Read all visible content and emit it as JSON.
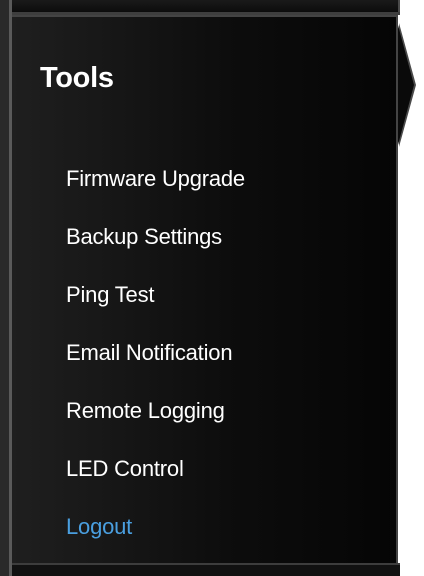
{
  "sidebar": {
    "title": "Tools",
    "items": [
      {
        "label": "Firmware Upgrade"
      },
      {
        "label": "Backup Settings"
      },
      {
        "label": "Ping Test"
      },
      {
        "label": "Email Notification"
      },
      {
        "label": "Remote Logging"
      },
      {
        "label": "LED Control"
      },
      {
        "label": "Logout"
      }
    ],
    "active_item_color": "#4a9fe0"
  }
}
